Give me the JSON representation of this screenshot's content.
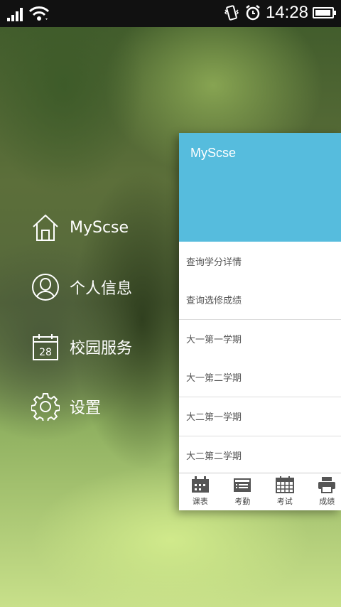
{
  "status_bar": {
    "time": "14:28",
    "icons": [
      "signal-icon",
      "wifi-icon",
      "vibrate-icon",
      "alarm-icon",
      "battery-icon"
    ]
  },
  "menu": {
    "items": [
      {
        "label": "MyScse",
        "icon": "home-icon"
      },
      {
        "label": "个人信息",
        "icon": "user-icon"
      },
      {
        "label": "校园服务",
        "icon": "calendar-icon",
        "icon_text": "28"
      },
      {
        "label": "设置",
        "icon": "gear-icon"
      }
    ]
  },
  "panel": {
    "title": "MyScse",
    "header_color": "#56bcdd",
    "rows": [
      "查询学分详情",
      "查询选修成绩",
      "大一第一学期",
      "大一第二学期",
      "大二第一学期",
      "大二第二学期"
    ],
    "tabs": [
      {
        "label": "课表",
        "icon": "calendar-grid-icon"
      },
      {
        "label": "考勤",
        "icon": "list-card-icon"
      },
      {
        "label": "考试",
        "icon": "calendar-table-icon"
      },
      {
        "label": "成绩",
        "icon": "printer-icon"
      }
    ]
  }
}
